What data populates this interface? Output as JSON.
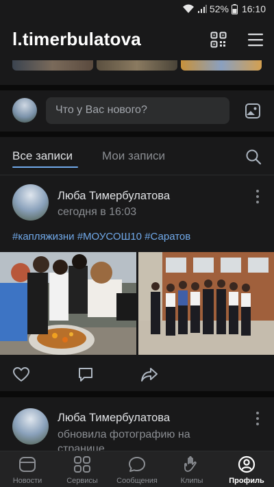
{
  "status_bar": {
    "battery": "52%",
    "time": "16:10"
  },
  "header": {
    "username": "l.timerbulatova"
  },
  "composer": {
    "placeholder": "Что у Вас нового?"
  },
  "tabs": [
    {
      "label": "Все записи",
      "active": true
    },
    {
      "label": "Мои записи",
      "active": false
    }
  ],
  "posts": [
    {
      "author": "Люба Тимербулатова",
      "subline": "сегодня в 16:03",
      "hashtags": "#капляжизни #МОУСОШ10  #Саратов"
    },
    {
      "author": "Люба Тимербулатова",
      "subline": "обновила фотографию на странице"
    }
  ],
  "bottom_nav": [
    {
      "label": "Новости",
      "icon": "news-icon"
    },
    {
      "label": "Сервисы",
      "icon": "services-icon"
    },
    {
      "label": "Сообщения",
      "icon": "messages-icon"
    },
    {
      "label": "Клипы",
      "icon": "clips-icon"
    },
    {
      "label": "Профиль",
      "icon": "profile-icon",
      "active": true
    }
  ],
  "colors": {
    "accent": "#71aaeb",
    "card": "#19191a",
    "background": "#0a0a0a"
  }
}
